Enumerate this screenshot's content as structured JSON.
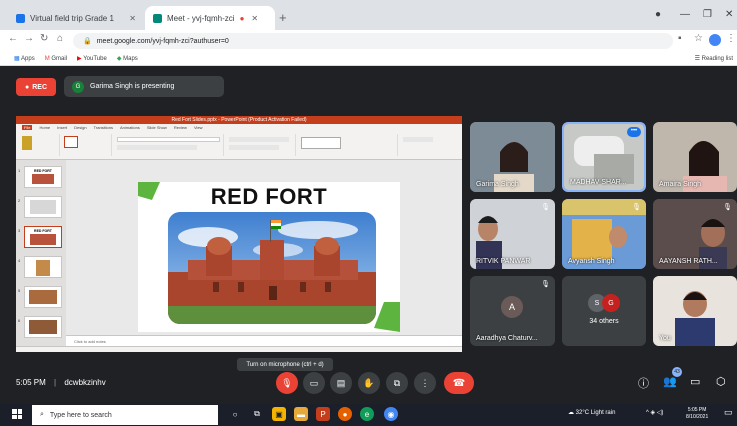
{
  "browser": {
    "tabs": [
      {
        "label": "Virtual field trip Grade 1",
        "favicon_color": "#1a73e8"
      },
      {
        "label": "Meet - yvj-fqmh-zci",
        "favicon_color": "#00897b"
      }
    ],
    "new_tab": "+",
    "address": "meet.google.com/yvj-fqmh-zci?authuser=0",
    "bookmarks": [
      "Apps",
      "Gmail",
      "YouTube",
      "Maps"
    ],
    "reading_list": "Reading list"
  },
  "meet": {
    "rec_label": "REC",
    "presenting_text": "Garima Singh is presenting",
    "presenter_initial": "G",
    "slide": {
      "window_title": "Red Fort Slides.pptx - PowerPoint (Product Activation Failed)",
      "ribbon_tabs": [
        "File",
        "Home",
        "Insert",
        "Design",
        "Transitions",
        "Animations",
        "Slide Show",
        "Review",
        "View"
      ],
      "title": "RED FORT",
      "notes_placeholder": "Click to add notes",
      "thumbnail_titles": [
        "RED FORT",
        "",
        "RED FORT",
        "",
        "",
        ""
      ]
    },
    "participants": [
      {
        "name": "Garima Singh",
        "type": "video"
      },
      {
        "name": "MADHAV SHAR...",
        "type": "video",
        "active": true
      },
      {
        "name": "Amaira Singh",
        "type": "video"
      },
      {
        "name": "RITVIK PANWAR",
        "type": "video"
      },
      {
        "name": "Avyansh Singh",
        "type": "video"
      },
      {
        "name": "AAYANSH RATH...",
        "type": "video"
      },
      {
        "name": "Aaradhya Chaturv...",
        "type": "avatar",
        "initial": "A",
        "avatar_color": "#6b5b58"
      },
      {
        "name": "34 others",
        "type": "others",
        "initials": [
          "S",
          "G"
        ]
      },
      {
        "name": "You",
        "type": "video"
      }
    ],
    "time": "5:05 PM",
    "separator": "|",
    "meeting_code": "dcwbkzinhv",
    "tooltip": "Turn on microphone (ctrl + d)",
    "participant_count": "43"
  },
  "taskbar": {
    "search_placeholder": "Type here to search",
    "weather": "32°C  Light rain",
    "clock_time": "5:05 PM",
    "clock_date": "8/10/2021"
  },
  "colors": {
    "meet_bg": "#202124",
    "tile_bg": "#3c4043",
    "danger": "#ea4335",
    "active_border": "#8ab4f8",
    "powerpoint": "#c43e1c",
    "accent_green": "#5db540"
  }
}
